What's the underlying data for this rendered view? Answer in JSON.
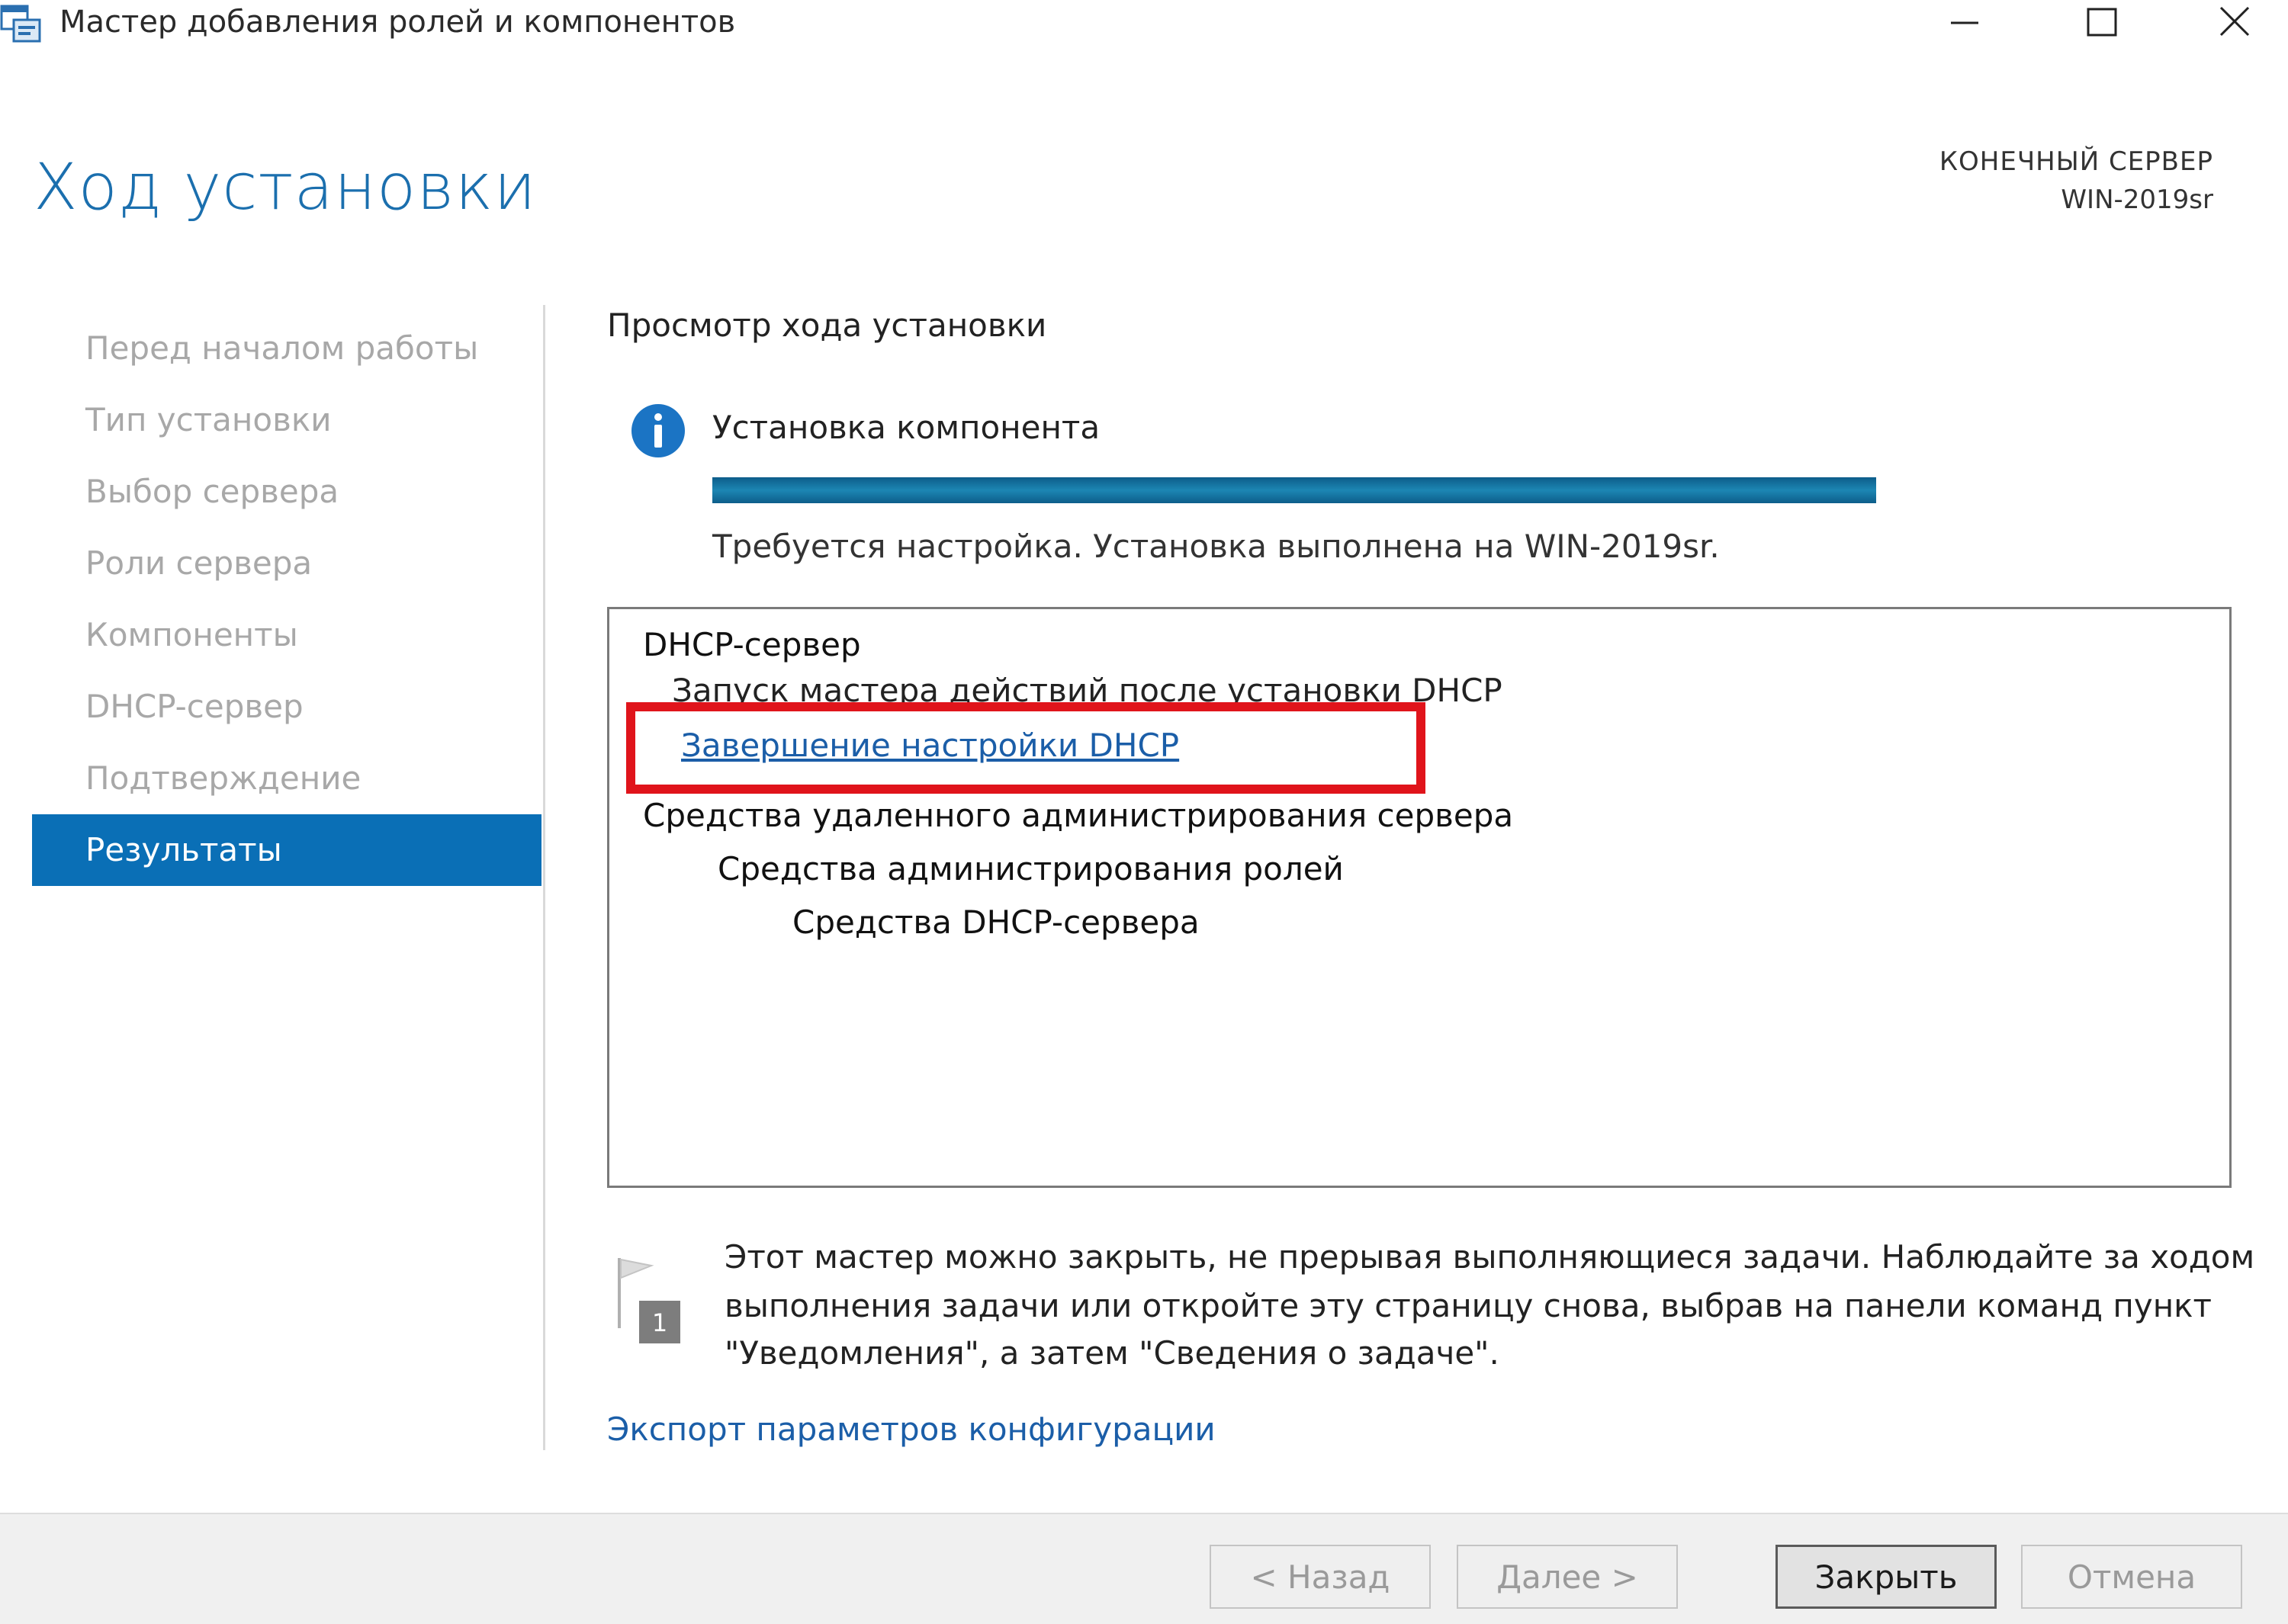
{
  "window": {
    "title": "Мастер добавления ролей и компонентов"
  },
  "header": {
    "page_title": "Ход установки",
    "destination_label": "КОНЕЧНЫЙ СЕРВЕР",
    "destination_value": "WIN-2019sr"
  },
  "nav": {
    "items": [
      {
        "label": "Перед началом работы",
        "active": false
      },
      {
        "label": "Тип установки",
        "active": false
      },
      {
        "label": "Выбор сервера",
        "active": false
      },
      {
        "label": "Роли сервера",
        "active": false
      },
      {
        "label": "Компоненты",
        "active": false
      },
      {
        "label": "DHCP-сервер",
        "active": false
      },
      {
        "label": "Подтверждение",
        "active": false
      },
      {
        "label": "Результаты",
        "active": true
      }
    ]
  },
  "main": {
    "heading": "Просмотр хода установки",
    "progress": {
      "title": "Установка компонента",
      "percent": 100,
      "status": "Требуется настройка. Установка выполнена на WIN-2019sr."
    },
    "results": {
      "dhcp_server": "DHCP-сервер",
      "dhcp_post_install": "Запуск мастера действий после установки DHCP",
      "complete_link": "Завершение настройки DHCP",
      "rsat": "Средства удаленного администрирования сервера",
      "role_admin_tools": "Средства администрирования ролей",
      "dhcp_tools": "Средства DHCP-сервера"
    },
    "note_lines": [
      "Этот мастер можно закрыть, не прерывая выполняющиеся задачи. Наблюдайте за ходом",
      "выполнения задачи или откройте эту страницу снова, выбрав на панели команд пункт",
      "\"Уведомления\", а затем \"Сведения о задаче\"."
    ],
    "flag_badge": "1",
    "export_link": "Экспорт параметров конфигурации"
  },
  "footer": {
    "back_label": "< Назад",
    "next_label": "Далее >",
    "close_label": "Закрыть",
    "cancel_label": "Отмена"
  },
  "colors": {
    "accent": "#0a6fb6",
    "link": "#1b5ea8",
    "highlight": "#e0141b",
    "progress": "#1c86b3"
  },
  "icons": [
    "wizard-app-icon",
    "info-icon",
    "flag-icon",
    "minimize-icon",
    "maximize-icon",
    "close-icon"
  ]
}
